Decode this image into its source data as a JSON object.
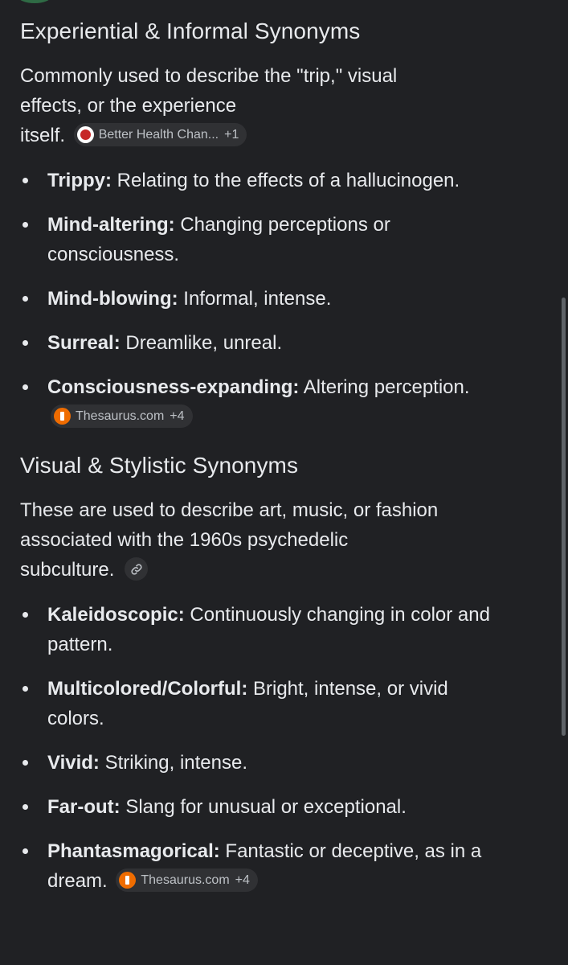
{
  "sections": [
    {
      "heading": "Experiential & Informal Synonyms",
      "intro_lines": [
        "Commonly used to describe the \"trip,\" visual",
        "effects, or the experience",
        "itself."
      ],
      "intro_chip": {
        "label": "Better Health Chan...",
        "more": "+1",
        "icon": "apple-icon"
      },
      "items": [
        {
          "term": "Trippy:",
          "desc": " Relating to the effects of a hallucinogen."
        },
        {
          "term": "Mind-altering:",
          "desc": " Changing perceptions or consciousness."
        },
        {
          "term": "Mind-blowing:",
          "desc": " Informal, intense."
        },
        {
          "term": "Surreal:",
          "desc": " Dreamlike, unreal."
        },
        {
          "term": "Consciousness-expanding:",
          "desc": " Altering perception.",
          "chip": {
            "label": "Thesaurus.com",
            "more": "+4",
            "icon": "thesaurus-icon"
          }
        }
      ]
    },
    {
      "heading": "Visual & Stylistic Synonyms",
      "intro_lines": [
        "These are used to describe art, music, or fashion",
        "associated with the 1960s psychedelic",
        "subculture."
      ],
      "intro_chip": {
        "icon": "link-icon"
      },
      "items": [
        {
          "term": "Kaleidoscopic:",
          "desc": " Continuously changing in color and pattern."
        },
        {
          "term": "Multicolored/Colorful:",
          "desc": " Bright, intense, or vivid colors."
        },
        {
          "term": "Vivid:",
          "desc": " Striking, intense."
        },
        {
          "term": "Far-out:",
          "desc": " Slang for unusual or exceptional."
        },
        {
          "term": "Phantasmagorical:",
          "desc": " Fantastic or deceptive, as in a dream.",
          "chip": {
            "label": "Thesaurus.com",
            "more": "+4",
            "icon": "thesaurus-icon"
          }
        }
      ]
    }
  ],
  "colors": {
    "background": "#202124",
    "text": "#e8eaed",
    "chip_background": "#303134",
    "chip_text": "#bdc1c6",
    "scrollbar": "#5f6368"
  }
}
